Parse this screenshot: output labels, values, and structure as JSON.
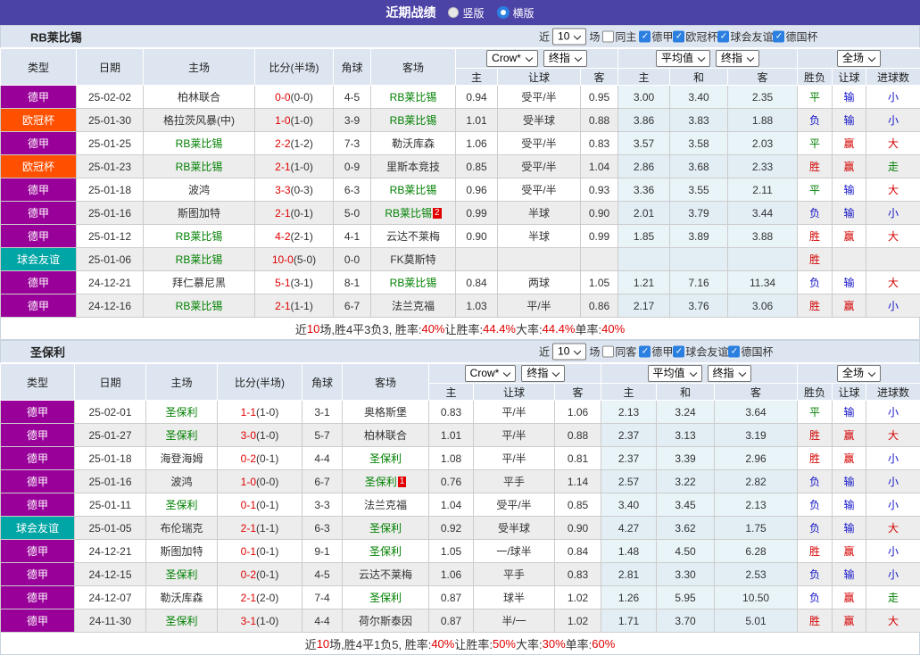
{
  "title_bar": {
    "title": "近期战绩",
    "radio_vertical": "竖版",
    "radio_horizontal": "横版",
    "selected": "横版"
  },
  "league_colors": {
    "德甲": "#990099",
    "欧冠杯": "#ff5000",
    "球会友谊": "#00a5a5"
  },
  "result_colors": {
    "胜": "#d40000",
    "赢": "#d40000",
    "大": "#d40000",
    "平": "#008000",
    "走": "#008000",
    "负": "#1414c8",
    "输": "#1414c8",
    "小": "#1414c8"
  },
  "accent": {
    "bar": "#4c43a6",
    "checkbox_blue": "#2a7fe0",
    "header_bg": "#dde6f0",
    "avg_bg": "#e9f4f9",
    "score_red": "#e00000",
    "team_green": "#008000"
  },
  "tables": [
    {
      "team": "RB莱比锡",
      "filter": {
        "near_label": "近",
        "count": "10",
        "unit": "场",
        "same_checked": false,
        "same_label": "同主",
        "leagues": [
          "德甲",
          "欧冠杯",
          "球会友谊",
          "德国杯"
        ]
      },
      "selects": {
        "odds_source": "Crow*",
        "odds_period": "终指",
        "avg": "平均值",
        "avg_period": "终指",
        "scope": "全场"
      },
      "columns": {
        "type": "类型",
        "date": "日期",
        "home": "主场",
        "score": "比分(半场)",
        "corner": "角球",
        "away": "客场",
        "sub": [
          "主",
          "让球",
          "客",
          "主",
          "和",
          "客",
          "胜负",
          "让球",
          "进球数"
        ]
      },
      "rows": [
        {
          "league": "德甲",
          "date": "25-02-02",
          "home": "柏林联合",
          "home_self": false,
          "score": "0-0",
          "half": "(0-0)",
          "corner": "4-5",
          "away": "RB莱比锡",
          "away_self": true,
          "away_card": null,
          "odds": [
            "0.94",
            "受平/半",
            "0.95"
          ],
          "avg": [
            "3.00",
            "3.40",
            "2.35"
          ],
          "res": [
            "平",
            "输",
            "小"
          ]
        },
        {
          "league": "欧冠杯",
          "date": "25-01-30",
          "home": "格拉茨风暴(中)",
          "home_self": false,
          "score": "1-0",
          "half": "(1-0)",
          "corner": "3-9",
          "away": "RB莱比锡",
          "away_self": true,
          "away_card": null,
          "odds": [
            "1.01",
            "受半球",
            "0.88"
          ],
          "avg": [
            "3.86",
            "3.83",
            "1.88"
          ],
          "res": [
            "负",
            "输",
            "小"
          ]
        },
        {
          "league": "德甲",
          "date": "25-01-25",
          "home": "RB莱比锡",
          "home_self": true,
          "score": "2-2",
          "half": "(1-2)",
          "corner": "7-3",
          "away": "勒沃库森",
          "away_self": false,
          "away_card": null,
          "odds": [
            "1.06",
            "受平/半",
            "0.83"
          ],
          "avg": [
            "3.57",
            "3.58",
            "2.03"
          ],
          "res": [
            "平",
            "赢",
            "大"
          ]
        },
        {
          "league": "欧冠杯",
          "date": "25-01-23",
          "home": "RB莱比锡",
          "home_self": true,
          "score": "2-1",
          "half": "(1-0)",
          "corner": "0-9",
          "away": "里斯本竞技",
          "away_self": false,
          "away_card": null,
          "odds": [
            "0.85",
            "受平/半",
            "1.04"
          ],
          "avg": [
            "2.86",
            "3.68",
            "2.33"
          ],
          "res": [
            "胜",
            "赢",
            "走"
          ]
        },
        {
          "league": "德甲",
          "date": "25-01-18",
          "home": "波鸿",
          "home_self": false,
          "score": "3-3",
          "half": "(0-3)",
          "corner": "6-3",
          "away": "RB莱比锡",
          "away_self": true,
          "away_card": null,
          "odds": [
            "0.96",
            "受平/半",
            "0.93"
          ],
          "avg": [
            "3.36",
            "3.55",
            "2.11"
          ],
          "res": [
            "平",
            "输",
            "大"
          ]
        },
        {
          "league": "德甲",
          "date": "25-01-16",
          "home": "斯图加特",
          "home_self": false,
          "score": "2-1",
          "half": "(0-1)",
          "corner": "5-0",
          "away": "RB莱比锡",
          "away_self": true,
          "away_card": "2",
          "odds": [
            "0.99",
            "半球",
            "0.90"
          ],
          "avg": [
            "2.01",
            "3.79",
            "3.44"
          ],
          "res": [
            "负",
            "输",
            "小"
          ]
        },
        {
          "league": "德甲",
          "date": "25-01-12",
          "home": "RB莱比锡",
          "home_self": true,
          "score": "4-2",
          "half": "(2-1)",
          "corner": "4-1",
          "away": "云达不莱梅",
          "away_self": false,
          "away_card": null,
          "odds": [
            "0.90",
            "半球",
            "0.99"
          ],
          "avg": [
            "1.85",
            "3.89",
            "3.88"
          ],
          "res": [
            "胜",
            "赢",
            "大"
          ]
        },
        {
          "league": "球会友谊",
          "date": "25-01-06",
          "home": "RB莱比锡",
          "home_self": true,
          "score": "10-0",
          "half": "(5-0)",
          "corner": "0-0",
          "away": "FK莫斯特",
          "away_self": false,
          "away_card": null,
          "odds": [
            "",
            "",
            ""
          ],
          "avg": [
            "",
            "",
            ""
          ],
          "res": [
            "胜",
            "",
            ""
          ]
        },
        {
          "league": "德甲",
          "date": "24-12-21",
          "home": "拜仁慕尼黑",
          "home_self": false,
          "score": "5-1",
          "half": "(3-1)",
          "corner": "8-1",
          "away": "RB莱比锡",
          "away_self": true,
          "away_card": null,
          "odds": [
            "0.84",
            "两球",
            "1.05"
          ],
          "avg": [
            "1.21",
            "7.16",
            "11.34"
          ],
          "res": [
            "负",
            "输",
            "大"
          ]
        },
        {
          "league": "德甲",
          "date": "24-12-16",
          "home": "RB莱比锡",
          "home_self": true,
          "score": "2-1",
          "half": "(1-1)",
          "corner": "6-7",
          "away": "法兰克福",
          "away_self": false,
          "away_card": null,
          "odds": [
            "1.03",
            "平/半",
            "0.86"
          ],
          "avg": [
            "2.17",
            "3.76",
            "3.06"
          ],
          "res": [
            "胜",
            "赢",
            "小"
          ]
        }
      ],
      "summary": [
        {
          "text": "近",
          "red": false
        },
        {
          "text": "10",
          "red": true
        },
        {
          "text": "场,胜4平3负3, 胜率:",
          "red": false
        },
        {
          "text": "40%",
          "red": true
        },
        {
          "text": " 让胜率:",
          "red": false
        },
        {
          "text": "44.4%",
          "red": true
        },
        {
          "text": " 大率:",
          "red": false
        },
        {
          "text": "44.4%",
          "red": true
        },
        {
          "text": " 单率:",
          "red": false
        },
        {
          "text": "40%",
          "red": true
        }
      ]
    },
    {
      "team": "圣保利",
      "filter": {
        "near_label": "近",
        "count": "10",
        "unit": "场",
        "same_checked": false,
        "same_label": "同客",
        "leagues": [
          "德甲",
          "球会友谊",
          "德国杯"
        ]
      },
      "selects": {
        "odds_source": "Crow*",
        "odds_period": "终指",
        "avg": "平均值",
        "avg_period": "终指",
        "scope": "全场"
      },
      "columns": {
        "type": "类型",
        "date": "日期",
        "home": "主场",
        "score": "比分(半场)",
        "corner": "角球",
        "away": "客场",
        "sub": [
          "主",
          "让球",
          "客",
          "主",
          "和",
          "客",
          "胜负",
          "让球",
          "进球数"
        ]
      },
      "rows": [
        {
          "league": "德甲",
          "date": "25-02-01",
          "home": "圣保利",
          "home_self": true,
          "score": "1-1",
          "half": "(1-0)",
          "corner": "3-1",
          "away": "奥格斯堡",
          "away_self": false,
          "away_card": null,
          "odds": [
            "0.83",
            "平/半",
            "1.06"
          ],
          "avg": [
            "2.13",
            "3.24",
            "3.64"
          ],
          "res": [
            "平",
            "输",
            "小"
          ]
        },
        {
          "league": "德甲",
          "date": "25-01-27",
          "home": "圣保利",
          "home_self": true,
          "score": "3-0",
          "half": "(1-0)",
          "corner": "5-7",
          "away": "柏林联合",
          "away_self": false,
          "away_card": null,
          "odds": [
            "1.01",
            "平/半",
            "0.88"
          ],
          "avg": [
            "2.37",
            "3.13",
            "3.19"
          ],
          "res": [
            "胜",
            "赢",
            "大"
          ]
        },
        {
          "league": "德甲",
          "date": "25-01-18",
          "home": "海登海姆",
          "home_self": false,
          "score": "0-2",
          "half": "(0-1)",
          "corner": "4-4",
          "away": "圣保利",
          "away_self": true,
          "away_card": null,
          "odds": [
            "1.08",
            "平/半",
            "0.81"
          ],
          "avg": [
            "2.37",
            "3.39",
            "2.96"
          ],
          "res": [
            "胜",
            "赢",
            "小"
          ]
        },
        {
          "league": "德甲",
          "date": "25-01-16",
          "home": "波鸿",
          "home_self": false,
          "score": "1-0",
          "half": "(0-0)",
          "corner": "6-7",
          "away": "圣保利",
          "away_self": true,
          "away_card": "1",
          "odds": [
            "0.76",
            "平手",
            "1.14"
          ],
          "avg": [
            "2.57",
            "3.22",
            "2.82"
          ],
          "res": [
            "负",
            "输",
            "小"
          ]
        },
        {
          "league": "德甲",
          "date": "25-01-11",
          "home": "圣保利",
          "home_self": true,
          "score": "0-1",
          "half": "(0-1)",
          "corner": "3-3",
          "away": "法兰克福",
          "away_self": false,
          "away_card": null,
          "odds": [
            "1.04",
            "受平/半",
            "0.85"
          ],
          "avg": [
            "3.40",
            "3.45",
            "2.13"
          ],
          "res": [
            "负",
            "输",
            "小"
          ]
        },
        {
          "league": "球会友谊",
          "date": "25-01-05",
          "home": "布伦瑞克",
          "home_self": false,
          "score": "2-1",
          "half": "(1-1)",
          "corner": "6-3",
          "away": "圣保利",
          "away_self": true,
          "away_card": null,
          "odds": [
            "0.92",
            "受半球",
            "0.90"
          ],
          "avg": [
            "4.27",
            "3.62",
            "1.75"
          ],
          "res": [
            "负",
            "输",
            "大"
          ]
        },
        {
          "league": "德甲",
          "date": "24-12-21",
          "home": "斯图加特",
          "home_self": false,
          "score": "0-1",
          "half": "(0-1)",
          "corner": "9-1",
          "away": "圣保利",
          "away_self": true,
          "away_card": null,
          "odds": [
            "1.05",
            "一/球半",
            "0.84"
          ],
          "avg": [
            "1.48",
            "4.50",
            "6.28"
          ],
          "res": [
            "胜",
            "赢",
            "小"
          ]
        },
        {
          "league": "德甲",
          "date": "24-12-15",
          "home": "圣保利",
          "home_self": true,
          "score": "0-2",
          "half": "(0-1)",
          "corner": "4-5",
          "away": "云达不莱梅",
          "away_self": false,
          "away_card": null,
          "odds": [
            "1.06",
            "平手",
            "0.83"
          ],
          "avg": [
            "2.81",
            "3.30",
            "2.53"
          ],
          "res": [
            "负",
            "输",
            "小"
          ]
        },
        {
          "league": "德甲",
          "date": "24-12-07",
          "home": "勒沃库森",
          "home_self": false,
          "score": "2-1",
          "half": "(2-0)",
          "corner": "7-4",
          "away": "圣保利",
          "away_self": true,
          "away_card": null,
          "odds": [
            "0.87",
            "球半",
            "1.02"
          ],
          "avg": [
            "1.26",
            "5.95",
            "10.50"
          ],
          "res": [
            "负",
            "赢",
            "走"
          ]
        },
        {
          "league": "德甲",
          "date": "24-11-30",
          "home": "圣保利",
          "home_self": true,
          "score": "3-1",
          "half": "(1-0)",
          "corner": "4-4",
          "away": "荷尔斯泰因",
          "away_self": false,
          "away_card": null,
          "odds": [
            "0.87",
            "半/一",
            "1.02"
          ],
          "avg": [
            "1.71",
            "3.70",
            "5.01"
          ],
          "res": [
            "胜",
            "赢",
            "大"
          ]
        }
      ],
      "summary": [
        {
          "text": "近",
          "red": false
        },
        {
          "text": "10",
          "red": true
        },
        {
          "text": "场,胜4平1负5, 胜率:",
          "red": false
        },
        {
          "text": "40%",
          "red": true
        },
        {
          "text": " 让胜率:",
          "red": false
        },
        {
          "text": "50%",
          "red": true
        },
        {
          "text": " 大率:",
          "red": false
        },
        {
          "text": "30%",
          "red": true
        },
        {
          "text": " 单率:",
          "red": false
        },
        {
          "text": "60%",
          "red": true
        }
      ]
    }
  ]
}
